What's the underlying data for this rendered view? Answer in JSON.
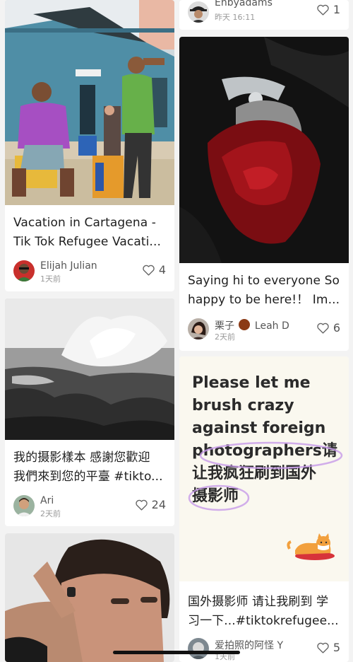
{
  "feed": {
    "left_column": [
      {
        "title_line1": "Vacation in Cartagena -",
        "title_line2": "Tik Tok Refugee Vacati...",
        "author": "Elijah Julian",
        "time": "1天前",
        "likes": "4",
        "image": "two-men-in-front-of-blue-house-photo"
      },
      {
        "title_line1": "我的摄影樣本 感謝您歡迎",
        "title_line2": "我們來到您的平臺 #tikto...",
        "author": "Ari",
        "time": "2天前",
        "likes": "24",
        "image": "black-and-white-wave-crashing-rocks-photo"
      },
      {
        "image": "man-portrait-hand-on-face-photo"
      }
    ],
    "right_column": [
      {
        "author": "Enbyadams",
        "time": "昨天 16:11",
        "likes": "1"
      },
      {
        "title_line1": "Saying hi to everyone So",
        "title_line2": "happy to be here!！ Im...",
        "author": "栗子",
        "author_extra": "Leah D",
        "time": "2天前",
        "likes": "6",
        "image": "dark-red-fabric-figure-photo"
      },
      {
        "poster_text_en": "Please let me brush crazy against foreign photographers",
        "poster_text_zh_1": "请",
        "poster_text_zh_2": "让我疯狂刷到国外",
        "poster_text_zh_3": "摄影师",
        "title_line1": "国外摄影师 请让我刷到 学",
        "title_line2": "习一下...#tiktokrefugee...",
        "author": "爱拍照的阿怪 Y",
        "time": "1天前",
        "likes": "5",
        "image": "cat-sticker"
      }
    ]
  },
  "colors": {
    "background": "#f3f3f3",
    "card": "#ffffff",
    "poster_bg": "#faf8ef",
    "highlight_circle": "#c79ae8"
  }
}
